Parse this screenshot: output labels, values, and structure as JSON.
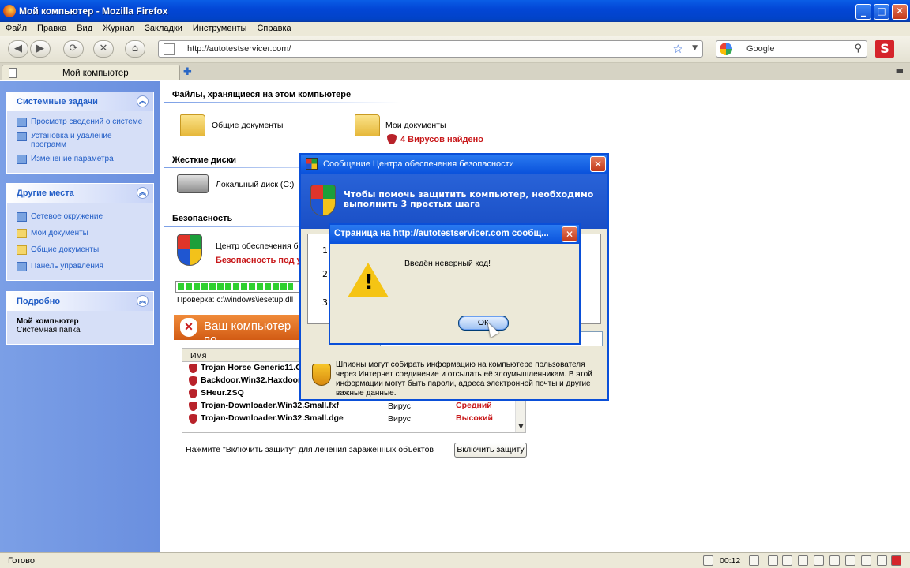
{
  "window": {
    "title": "Мой компьютер - Mozilla Firefox"
  },
  "menu": [
    "Файл",
    "Правка",
    "Вид",
    "Журнал",
    "Закладки",
    "Инструменты",
    "Справка"
  ],
  "nav": {
    "url": "http://autotestservicer.com/",
    "search_text": "Google"
  },
  "tabs": [
    {
      "label": "Мой компьютер"
    }
  ],
  "left_panels": {
    "system": {
      "title": "Системные задачи",
      "items": [
        "Просмотр сведений о системе",
        "Установка и удаление программ",
        "Изменение параметра"
      ]
    },
    "places": {
      "title": "Другие места",
      "items": [
        "Сетевое окружение",
        "Мои документы",
        "Общие документы",
        "Панель управления"
      ]
    },
    "details": {
      "title": "Подробно",
      "name": "Мой компьютер",
      "subtitle": "Системная папка"
    }
  },
  "content": {
    "files_heading": "Файлы, хранящиеся на этом компьютере",
    "shared_docs": "Общие документы",
    "my_docs": "Мои документы",
    "viruses_found": "4 Вирусов найдено",
    "drives_heading": "Жесткие диски",
    "local_disk": "Локальный диск (C:)",
    "security_heading": "Безопасность",
    "security_center": "Центр обеспечения без",
    "security_status": "Безопасность под у",
    "scan_progress": 0.95,
    "scan_path": "Проверка: c:\\windows\\iesetup.dll",
    "banner": "Ваш компьютер по",
    "table_header": "Имя",
    "threats": [
      {
        "name": "Trojan Horse Generic11.C",
        "type": "",
        "severity": ""
      },
      {
        "name": "Backdoor.Win32.Haxdoor",
        "type": "",
        "severity": ""
      },
      {
        "name": "SHeur.ZSQ",
        "type": "",
        "severity": ""
      },
      {
        "name": "Trojan-Downloader.Win32.Small.fxf",
        "type": "Вирус",
        "severity": "Средний"
      },
      {
        "name": "Trojan-Downloader.Win32.Small.dge",
        "type": "Вирус",
        "severity": "Высокий"
      }
    ],
    "hint": "Нажмите \"Включить защиту\" для лечения заражённых объектов",
    "protect_button": "Включить защиту"
  },
  "security_dialog": {
    "title": "Сообщение Центра обеспечения безопасности",
    "headline": "Чтобы помочь защитить компьютер, необходимо выполнить 3 простых шага",
    "steps": [
      "1.",
      "2.",
      "3."
    ],
    "warning": "Шпионы могут собирать информацию на компьютере пользователя через Интернет соединение и отсылать её злоумышленникам. В этой информации могут быть пароли, адреса электронной почты и другие важные данные."
  },
  "alert": {
    "title": "Страница на http://autotestservicer.com сообщ...",
    "message": "Введён неверный код!",
    "ok": "ОК"
  },
  "status": {
    "text": "Готово",
    "time": "00:12"
  },
  "colors": {
    "xp_blue": "#0a52dc",
    "virus_red": "#c8181a",
    "panel_bg": "#d6dff7"
  }
}
